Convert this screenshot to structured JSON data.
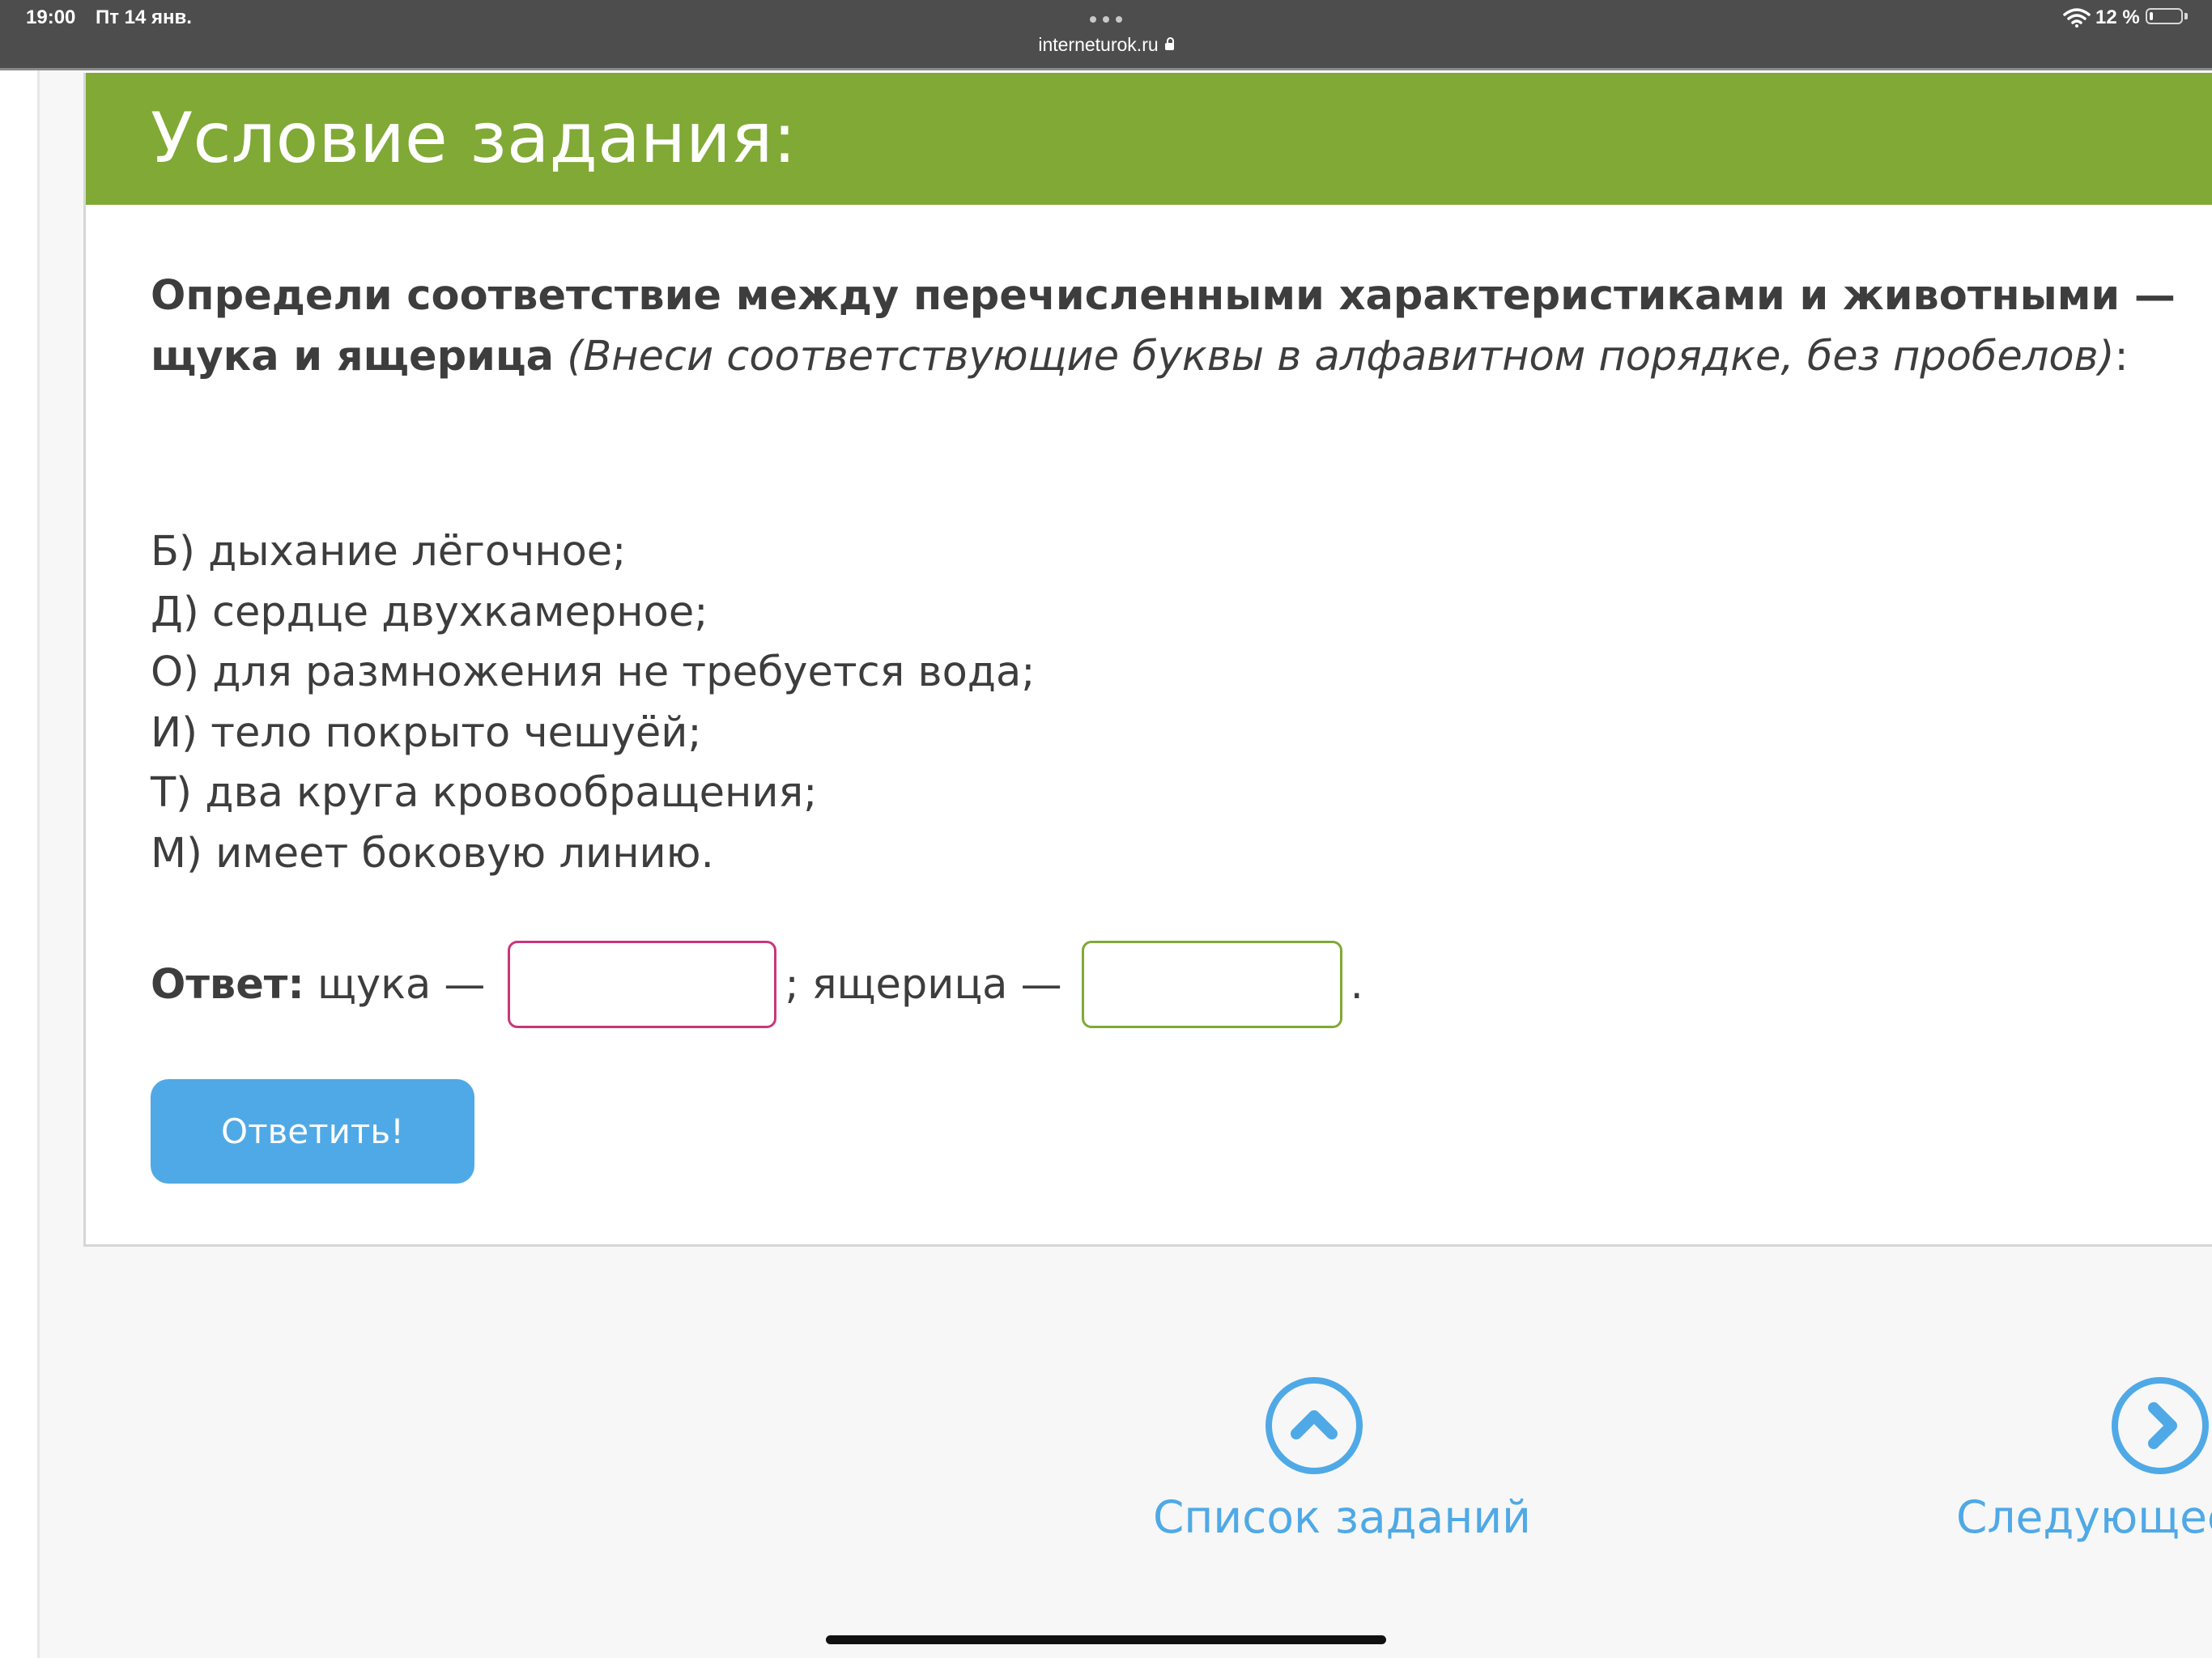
{
  "status_bar": {
    "time": "19:00",
    "date": "Пт 14 янв.",
    "url": "interneturok.ru",
    "battery_text": "12 %",
    "battery_level": 0.12
  },
  "task": {
    "title": "Условие задания:",
    "question_bold": "Определи соответствие между перечисленными характеристиками и животными — щука и ящерица",
    "question_italic": "(Внеси соответствующие буквы в алфавитном порядке, без пробелов)",
    "question_tail": ":",
    "options": [
      "Б) дыхание лёгочное;",
      "Д) сердце двухкамерное;",
      "О) для размножения не требуется вода;",
      "И) тело покрыто чешуёй;",
      "Т) два круга кровообращения;",
      "М) имеет боковую линию."
    ],
    "answer_label": "Ответ:",
    "pike_label": " щука —",
    "pike_value": "",
    "lizard_label": "; ящерица —",
    "lizard_value": "",
    "end_mark": ".",
    "submit_label": "Ответить!"
  },
  "navigation": {
    "task_list_label": "Список заданий",
    "next_label": "Следующее з"
  },
  "colors": {
    "header_green": "#80a935",
    "accent_blue": "#4fa9e6",
    "pike_border": "#c9367a",
    "lizard_border": "#80a935",
    "text": "#3d3d3d"
  }
}
